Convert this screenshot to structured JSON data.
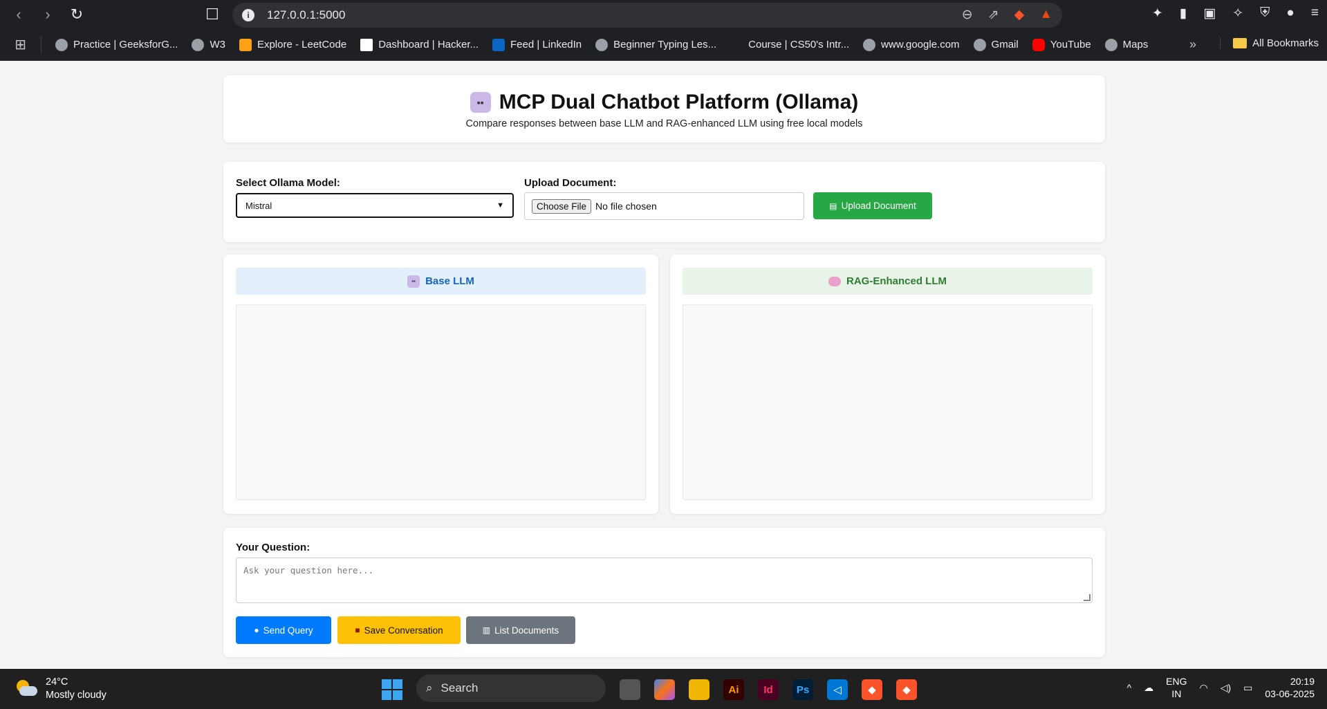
{
  "browser": {
    "url": "127.0.0.1:5000",
    "bookmarks": [
      {
        "label": "Practice | GeeksforG...",
        "icon": "globe-icon"
      },
      {
        "label": "W3",
        "icon": "globe-icon"
      },
      {
        "label": "Explore - LeetCode",
        "icon": "leetcode-icon"
      },
      {
        "label": "Dashboard | Hacker...",
        "icon": "hackerrank-icon"
      },
      {
        "label": "Feed | LinkedIn",
        "icon": "linkedin-icon"
      },
      {
        "label": "Beginner Typing Les...",
        "icon": "globe-icon"
      },
      {
        "label": "Course | CS50's Intr...",
        "icon": "edx-icon"
      },
      {
        "label": "www.google.com",
        "icon": "globe-icon"
      },
      {
        "label": "Gmail",
        "icon": "globe-icon"
      },
      {
        "label": "YouTube",
        "icon": "youtube-icon"
      },
      {
        "label": "Maps",
        "icon": "globe-icon"
      }
    ],
    "all_bookmarks": "All Bookmarks"
  },
  "header": {
    "title": "MCP Dual Chatbot Platform (Ollama)",
    "subtitle": "Compare responses between base LLM and RAG-enhanced LLM using free local models"
  },
  "controls": {
    "model_label": "Select Ollama Model:",
    "model_selected": "Mistral",
    "upload_label": "Upload Document:",
    "choose_file": "Choose File",
    "no_file": "No file chosen",
    "upload_button": "Upload Document"
  },
  "panels": {
    "base_title": "Base LLM",
    "rag_title": "RAG-Enhanced LLM"
  },
  "question": {
    "label": "Your Question:",
    "placeholder": "Ask your question here...",
    "send_button": "Send Query",
    "save_button": "Save Conversation",
    "list_button": "List Documents"
  },
  "colors": {
    "upload_green": "#28a745",
    "send_blue": "#007bff",
    "save_yellow": "#ffc107",
    "list_gray": "#6c757d",
    "base_header_text": "#1565c0",
    "rag_header_text": "#2e7d32"
  },
  "taskbar": {
    "temperature": "24°C",
    "weather": "Mostly cloudy",
    "search": "Search",
    "lang_1": "ENG",
    "lang_2": "IN",
    "time": "20:19",
    "date": "03-06-2025"
  }
}
